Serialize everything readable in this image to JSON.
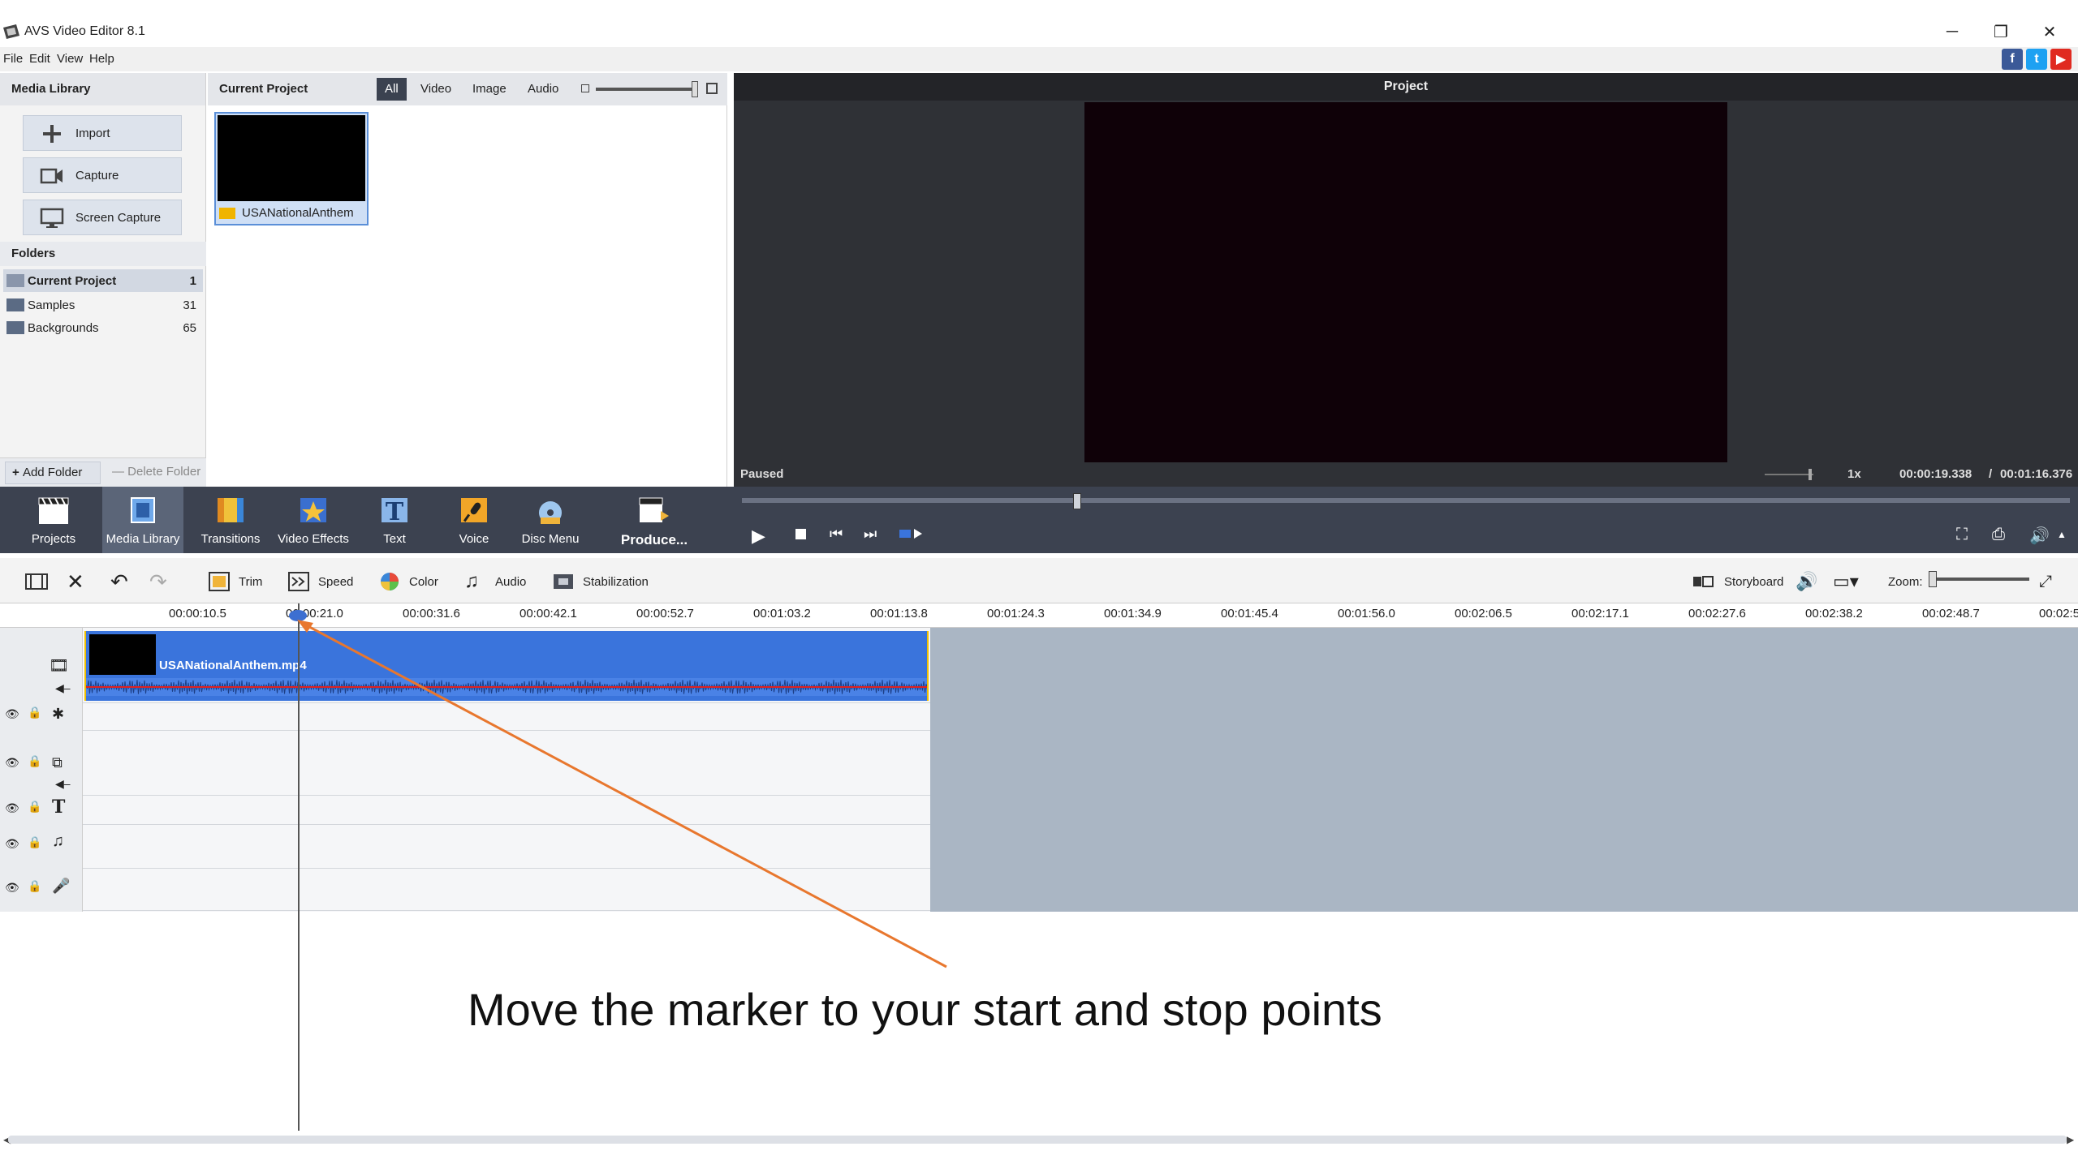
{
  "window": {
    "title": "AVS Video Editor 8.1"
  },
  "menu": [
    "File",
    "Edit",
    "View",
    "Help"
  ],
  "media_library": {
    "header": "Media Library",
    "buttons": [
      "Import",
      "Capture",
      "Screen Capture"
    ],
    "folders_header": "Folders",
    "folders": [
      {
        "name": "Current Project",
        "count": "1"
      },
      {
        "name": "Samples",
        "count": "31"
      },
      {
        "name": "Backgrounds",
        "count": "65"
      }
    ],
    "add_folder": "Add Folder",
    "delete_folder": "Delete Folder"
  },
  "current_project": {
    "header": "Current Project",
    "filters": [
      "All",
      "Video",
      "Image",
      "Audio"
    ],
    "selected_filter": "All",
    "thumb_label": "USANationalAnthem"
  },
  "preview": {
    "header": "Project",
    "status": "Paused",
    "speed": "1x",
    "time_current": "00:00:19.338",
    "time_total": "00:01:16.376"
  },
  "mainbar": [
    "Projects",
    "Media Library",
    "Transitions",
    "Video Effects",
    "Text",
    "Voice",
    "Disc Menu",
    "Produce..."
  ],
  "timeline_toolbar": {
    "trim": "Trim",
    "speed": "Speed",
    "color": "Color",
    "audio": "Audio",
    "stabilization": "Stabilization",
    "storyboard": "Storyboard",
    "zoom": "Zoom:"
  },
  "ruler_ticks": [
    "00:00:10.5",
    "00:00:21.0",
    "00:00:31.6",
    "00:00:42.1",
    "00:00:52.7",
    "00:01:03.2",
    "00:01:13.8",
    "00:01:24.3",
    "00:01:34.9",
    "00:01:45.4",
    "00:01:56.0",
    "00:02:06.5",
    "00:02:17.1",
    "00:02:27.6",
    "00:02:38.2",
    "00:02:48.7",
    "00:02:5"
  ],
  "clip": {
    "name": "USANationalAnthem.mp4"
  },
  "annotation": {
    "caption": "Move the marker to your start and stop points",
    "arrow_color": "#e8772e"
  },
  "colors": {
    "accent": "#3a74dc",
    "toolbar": "#3c4250"
  }
}
